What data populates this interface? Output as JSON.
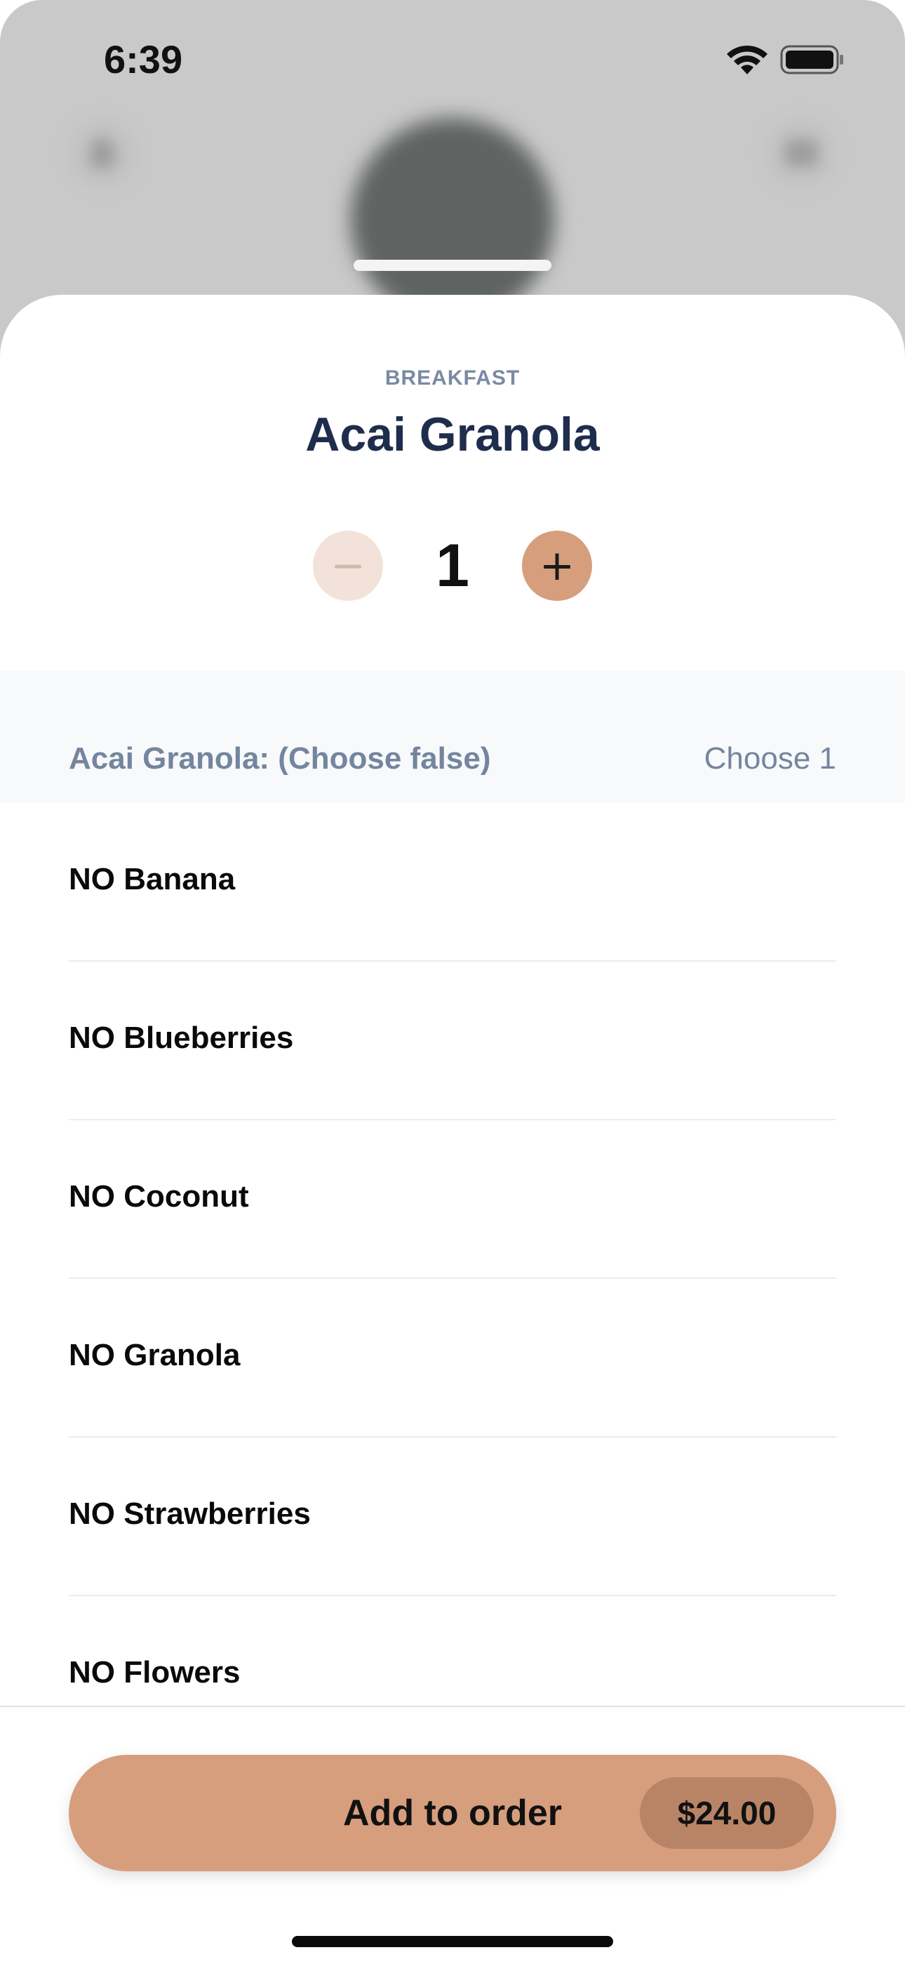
{
  "status_bar": {
    "time": "6:39"
  },
  "product": {
    "category": "BREAKFAST",
    "title": "Acai Granola",
    "quantity": "1"
  },
  "quantity_controls": {
    "minus_symbol": "−",
    "plus_symbol": "+"
  },
  "modifier_group": {
    "title": "Acai Granola: (Choose false)",
    "rule": "Choose 1",
    "options": [
      {
        "label": "NO Banana"
      },
      {
        "label": "NO Blueberries"
      },
      {
        "label": "NO Coconut"
      },
      {
        "label": "NO Granola"
      },
      {
        "label": "NO Strawberries"
      },
      {
        "label": "NO Flowers"
      }
    ]
  },
  "footer": {
    "add_label": "Add to order",
    "price": "$24.00"
  },
  "colors": {
    "accent": "#d69e7d",
    "accent_dark": "#b98466",
    "title": "#1f2d4d",
    "muted": "#74859f"
  }
}
